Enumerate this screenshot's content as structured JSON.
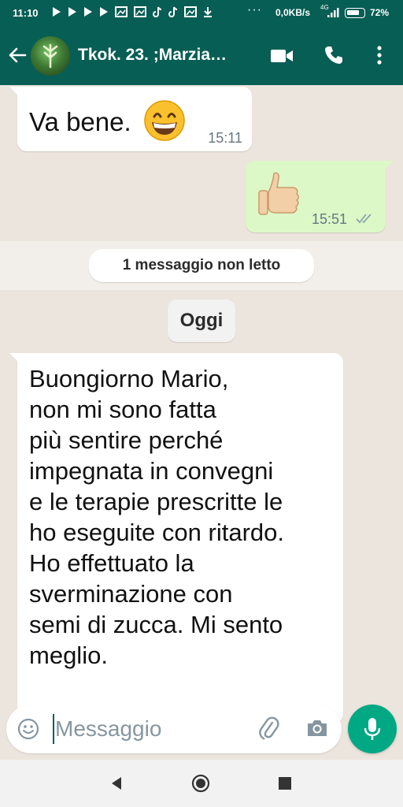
{
  "status_bar": {
    "time": "11:10",
    "notification_icons": [
      "play-store-icon",
      "play-store-icon",
      "play-store-icon",
      "play-store-icon",
      "gallery-icon",
      "gallery-icon",
      "tiktok-icon",
      "tiktok-icon",
      "gallery-icon",
      "download-icon"
    ],
    "more": "···",
    "speed": "0,0KB/s",
    "network": "4G",
    "battery": "72%"
  },
  "header": {
    "title": "Tkok. 23. ;Marzia…",
    "accent_color": "#075e54"
  },
  "messages": [
    {
      "direction": "in",
      "text": "Va bene.",
      "emoji": "grinning-face",
      "time": "15:11"
    },
    {
      "direction": "out",
      "emoji": "thumbs-up",
      "time": "15:51",
      "status": "read-double-tick"
    },
    {
      "direction": "in",
      "text": "Buongiorno Mario,\nnon mi sono fatta\npiù sentire perché\nimpegnata in convegni\ne le terapie prescritte le\nho eseguite con ritardo.\nHo effettuato la\nsverminazione con\nsemi di zucca. Mi sento\nmeglio."
    }
  ],
  "unread_banner": "1 messaggio non letto",
  "date_divider": "Oggi",
  "composer": {
    "placeholder": "Messaggio",
    "send_color": "#00a884"
  }
}
